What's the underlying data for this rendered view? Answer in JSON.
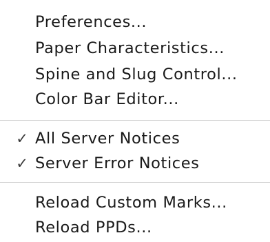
{
  "menu": {
    "items": [
      {
        "label": "Preferences...",
        "checked": false
      },
      {
        "label": "Paper Characteristics...",
        "checked": false
      },
      {
        "label": "Spine and Slug Control...",
        "checked": false
      },
      {
        "label": "Color Bar Editor...",
        "checked": false
      },
      {
        "label": "All Server Notices",
        "checked": true,
        "check_mark": "✓"
      },
      {
        "label": "Server Error Notices",
        "checked": true,
        "check_mark": "✓"
      },
      {
        "label": "Reload Custom Marks...",
        "checked": false
      },
      {
        "label": "Reload PPDs...",
        "checked": false
      }
    ]
  },
  "colors": {
    "text": "#1a1a1a",
    "separator": "#cfcfcf",
    "background": "#ffffff"
  }
}
